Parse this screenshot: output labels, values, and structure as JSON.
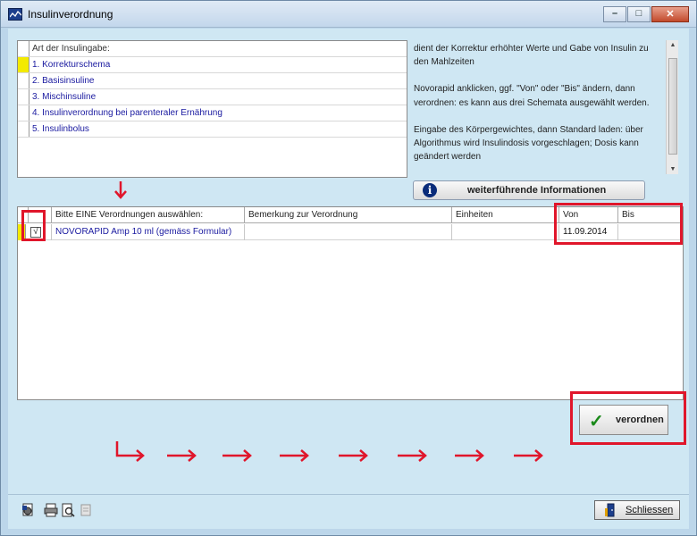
{
  "window": {
    "title": "Insulinverordnung"
  },
  "insulin_types": {
    "header": "Art der Insulingabe:",
    "items": [
      {
        "label": "1. Korrekturschema",
        "selected": true
      },
      {
        "label": "2. Basisinsuline",
        "selected": false
      },
      {
        "label": "3. Mischinsuline",
        "selected": false
      },
      {
        "label": "4. Insulinverordnung bei parenteraler Ernährung",
        "selected": false
      },
      {
        "label": "5. Insulinbolus",
        "selected": false
      }
    ]
  },
  "description": {
    "p1": "dient der Korrektur erhöhter Werte und Gabe von Insulin zu den Mahlzeiten",
    "p2": "Novorapid anklicken, ggf. \"Von\" oder \"Bis\" ändern, dann verordnen: es kann aus drei Schemata ausgewählt werden.",
    "p3": "Eingabe des Körpergewichtes, dann Standard laden: über Algorithmus wird Insulindosis vorgeschlagen; Dosis kann geändert werden"
  },
  "info_button": {
    "label": "weiterführende Informationen"
  },
  "orders_table": {
    "columns": [
      "Bitte EINE Verordnungen auswählen:",
      "Bemerkung zur Verordnung",
      "Einheiten",
      "Von",
      "Bis"
    ],
    "rows": [
      {
        "checked": true,
        "check_glyph": "√",
        "name": "NOVORAPID Amp 10 ml (gemäss Formular)",
        "remark": "",
        "units": "",
        "from": "11.09.2014",
        "to": ""
      }
    ]
  },
  "order_button": {
    "label": "verordnen"
  },
  "close_button": {
    "label": "Schliessen"
  },
  "colors": {
    "annotation": "#e0162b",
    "selection": "#f3ea00",
    "link_text": "#1a1aa0"
  }
}
